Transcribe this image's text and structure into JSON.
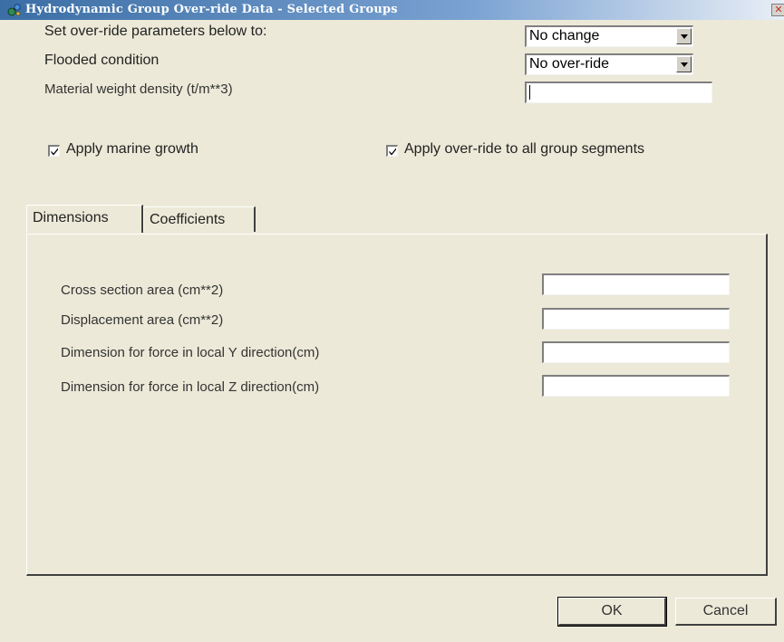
{
  "window": {
    "title": "Hydrodynamic Group Over-ride Data - Selected Groups",
    "close_glyph": "✕"
  },
  "top": {
    "set_label": "Set over-ride parameters below to:",
    "set_value": "No change",
    "flooded_label": "Flooded condition",
    "flooded_value": "No over-ride",
    "density_label": "Material weight density (t/m**3)",
    "density_value": "",
    "marine_growth_label": "Apply marine growth",
    "marine_growth_checked": true,
    "all_segments_label": "Apply over-ride to all group segments",
    "all_segments_checked": true
  },
  "tabs": [
    {
      "label": "Dimensions",
      "active": true
    },
    {
      "label": "Coefficients",
      "active": false
    }
  ],
  "dimensions": {
    "fields": [
      {
        "label": "Cross section area  (cm**2)",
        "value": ""
      },
      {
        "label": "Displacement area (cm**2)",
        "value": ""
      },
      {
        "label": "Dimension for force in local Y direction(cm)",
        "value": ""
      },
      {
        "label": "Dimension for force in local Z direction(cm)",
        "value": ""
      }
    ]
  },
  "buttons": {
    "ok": "OK",
    "cancel": "Cancel"
  },
  "icons": {
    "app": "gear-molecule-icon",
    "close": "close-icon",
    "dropdown": "chevron-down-icon",
    "check": "checkmark-icon"
  }
}
